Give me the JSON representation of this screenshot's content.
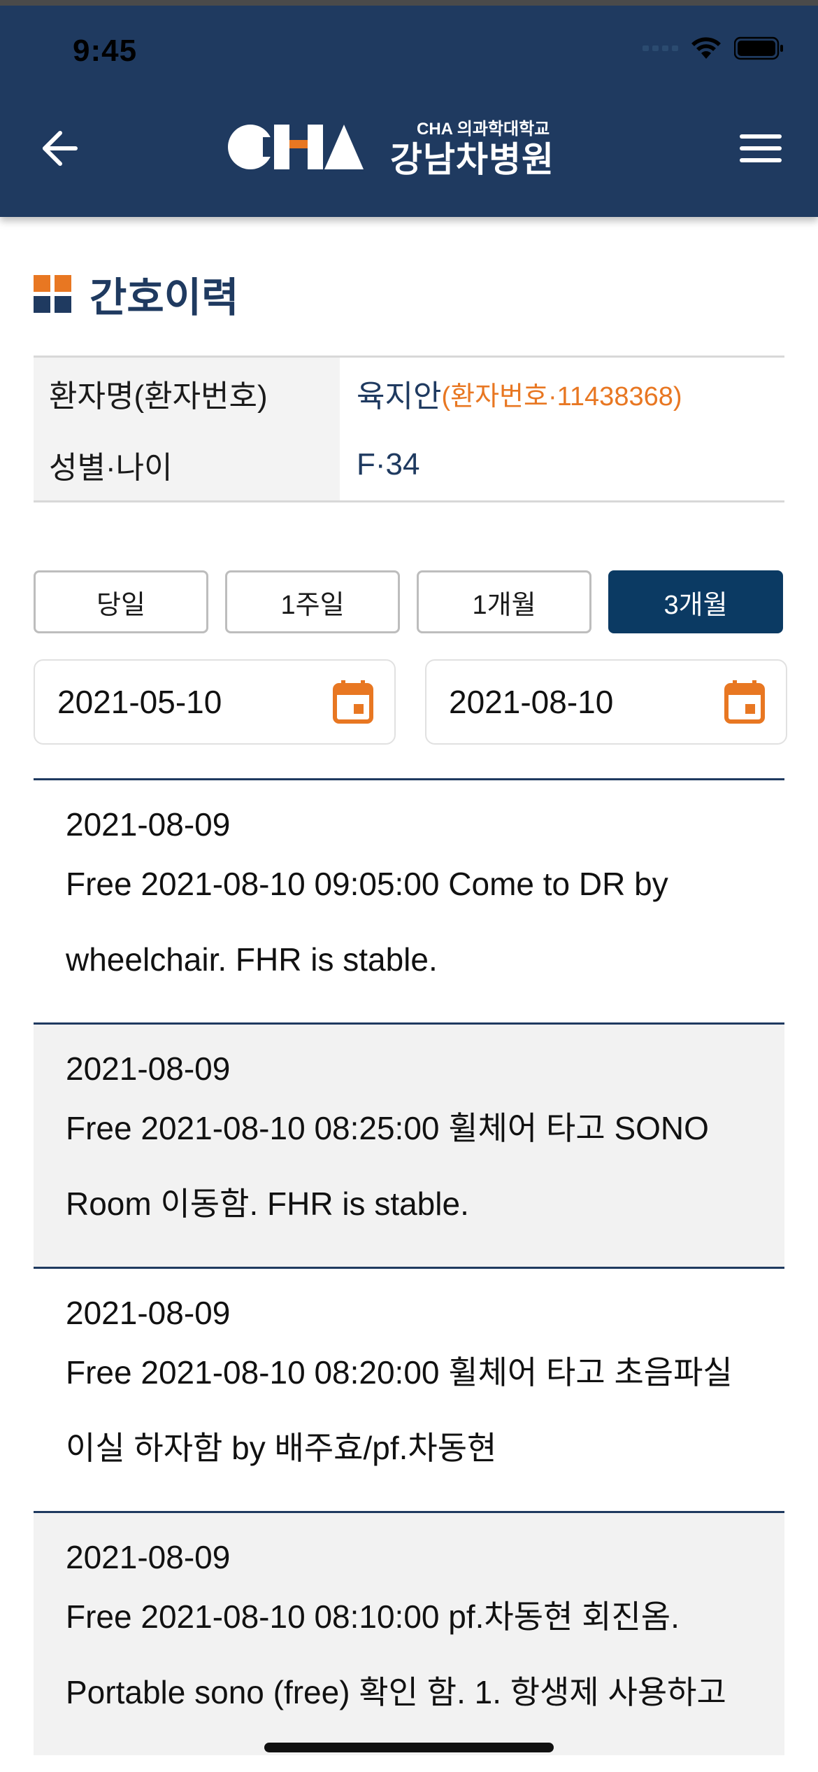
{
  "status_bar": {
    "time": "9:45"
  },
  "header": {
    "logo_subtitle": "CHA 의과학대학교",
    "logo_title": "강남차병원"
  },
  "colors": {
    "navy": "#1f3a60",
    "accent_orange": "#e87722",
    "active_button": "#0b3a63"
  },
  "page": {
    "title": "간호이력"
  },
  "patient": {
    "name_label": "환자명(환자번호)",
    "name": "육지안",
    "id_text": "(환자번호·11438368)",
    "sex_age_label": "성별·나이",
    "sex_age": "F·34"
  },
  "period_buttons": [
    {
      "label": "당일",
      "selected": false
    },
    {
      "label": "1주일",
      "selected": false
    },
    {
      "label": "1개월",
      "selected": false
    },
    {
      "label": "3개월",
      "selected": true
    }
  ],
  "date_range": {
    "start": "2021-05-10",
    "end": "2021-08-10"
  },
  "records": [
    {
      "date": "2021-08-09",
      "text": "Free  2021-08-10 09:05:00  Come to DR by wheelchair. FHR is stable."
    },
    {
      "date": "2021-08-09",
      "text": "Free  2021-08-10 08:25:00  휠체어 타고 SONO Room 이동함. FHR is stable."
    },
    {
      "date": "2021-08-09",
      "text": "Free  2021-08-10 08:20:00  휠체어 타고 초음파실 이실 하자함 by 배주효/pf.차동현"
    },
    {
      "date": "2021-08-09",
      "text": "Free  2021-08-10 08:10:00  pf.차동현 회진옴. Portable sono (free) 확인 함. 1. 항생제 사용하고"
    }
  ]
}
